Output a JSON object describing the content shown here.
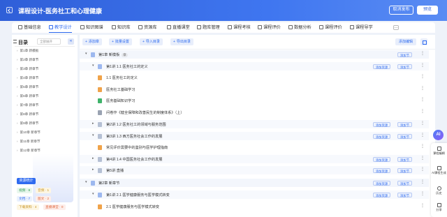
{
  "header": {
    "title": "课程设计-医务社工和心理健康",
    "cancel_label": "取消发布",
    "preview_label": "预览"
  },
  "tabs": [
    {
      "label": "基础信息"
    },
    {
      "label": "教学设计"
    },
    {
      "label": "知识图谱"
    },
    {
      "label": "知识库"
    },
    {
      "label": "资源库"
    },
    {
      "label": "直播课堂"
    },
    {
      "label": "题库管理"
    },
    {
      "label": "课程考核"
    },
    {
      "label": "课程评价"
    },
    {
      "label": "数据分析"
    },
    {
      "label": "课程评价"
    },
    {
      "label": "课程导学"
    }
  ],
  "tab_more": "…",
  "outline": {
    "title": "目录",
    "select_value": "全部展开",
    "items": [
      "第1章 新模板",
      "第2章 新章节",
      "第3章 新章节",
      "第4章 新章节",
      "第5章 新章节",
      "第6章 新章节",
      "第7章 新章节",
      "第8章 新章节",
      "第9章 新章节",
      "第10章 新章节",
      "第11章 新章节",
      "第12章 新章节"
    ],
    "stats_title": "资源统计",
    "stats": [
      {
        "label": "视频 · 8",
        "color": "#e9f7ee",
        "text": "#2f9a55"
      },
      {
        "label": "音频 · 1",
        "color": "#fdf6e3",
        "text": "#c6921f"
      },
      {
        "label": "文档 · 7",
        "color": "#eaf1fd",
        "text": "#2f6bf0"
      },
      {
        "label": "图文 · 2",
        "color": "#fdeeea",
        "text": "#e0663c"
      },
      {
        "label": "下载资料 · 4",
        "color": "#fdf6e3",
        "text": "#c6921f"
      },
      {
        "label": "直播课堂 · 0",
        "color": "#fdeeea",
        "text": "#e0663c"
      }
    ]
  },
  "toolbar": {
    "buttons": [
      "添加章",
      "批量设置",
      "导入目录",
      "导出目录"
    ],
    "add_label": "添加编辑"
  },
  "rows": [
    {
      "text": "第1章  新模板",
      "chip": "章",
      "actions": [
        "添加节"
      ]
    },
    {
      "text": "第1讲  1.1 医务社工的定义",
      "actions": [
        "添加资源",
        "添加节"
      ]
    },
    {
      "text": "1.1 医务社工的定义",
      "actions": []
    },
    {
      "text": "医务社工基础学习",
      "actions": []
    },
    {
      "text": "医务基础知识学习",
      "actions": []
    },
    {
      "text": "问卷作《健全保障和改善民生的制度体系》（上）",
      "actions": []
    },
    {
      "text": "第2讲  1.2 医务社工的领域与服务范围",
      "actions": [
        "添加资源",
        "添加节"
      ]
    },
    {
      "text": "第3讲  1.3 西方医务社会工作的发展",
      "actions": [
        "添加资源",
        "添加节"
      ]
    },
    {
      "text": "常见评价需要中的鉴别与医学护理指南",
      "actions": []
    },
    {
      "text": "第4讲  1.4 中国医务社会工作的发展",
      "actions": [
        "添加资源",
        "添加节"
      ]
    },
    {
      "text": "第5讲  直播",
      "actions": [
        "添加资源",
        "添加节"
      ]
    },
    {
      "text": "第2章  新章节",
      "chip": "",
      "actions": [
        "添加资源",
        "添加节"
      ]
    },
    {
      "text": "第1讲  2.1 医学健康服务与医学模式转变",
      "actions": [
        "添加资源",
        "添加节"
      ]
    },
    {
      "text": "2.1 医学健康服务与医学模式转变",
      "actions": []
    }
  ],
  "float": {
    "ai_label": "AI",
    "items": [
      "课程编辑",
      "AI课程生成",
      "历史",
      "分享"
    ]
  }
}
